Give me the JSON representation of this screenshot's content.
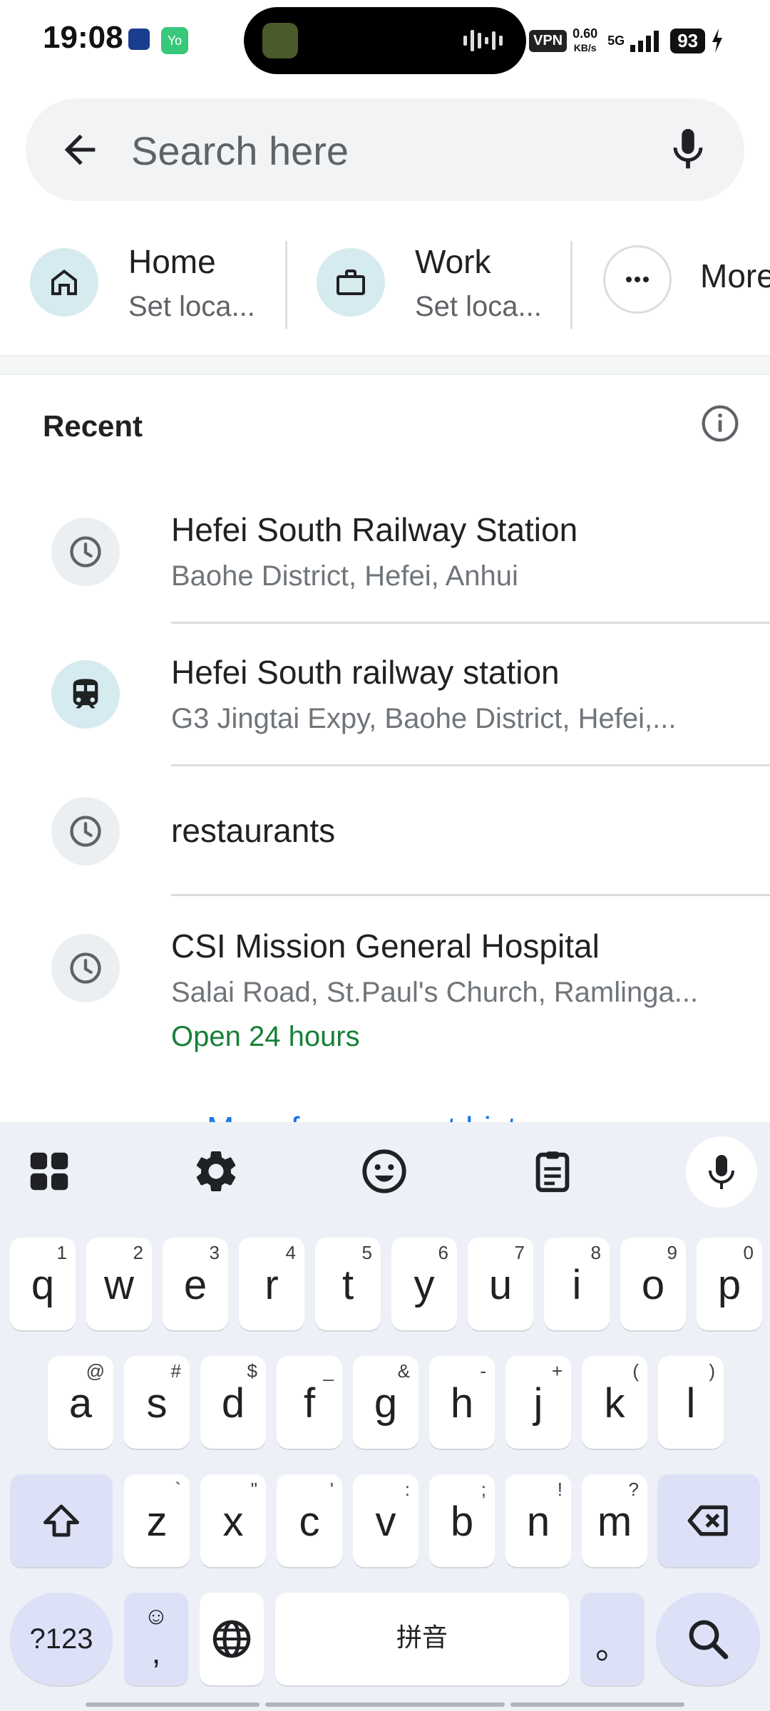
{
  "status_bar": {
    "time": "19:08",
    "app_badge": "Yo",
    "vpn": "VPN",
    "speed_value": "0.60",
    "speed_unit": "KB/s",
    "network": "5G",
    "battery": "93",
    "icons": [
      "app-notification-icon",
      "app-notification-icon",
      "audio-wave-icon",
      "signal-icon",
      "charging-icon"
    ]
  },
  "search": {
    "placeholder": "Search here",
    "back_icon": "arrow-left-icon",
    "mic_icon": "mic-icon"
  },
  "shortcuts": [
    {
      "title": "Home",
      "subtitle": "Set loca...",
      "icon": "home-icon"
    },
    {
      "title": "Work",
      "subtitle": "Set loca...",
      "icon": "briefcase-icon"
    },
    {
      "title": "More",
      "icon": "more-horiz-icon"
    }
  ],
  "recent": {
    "title": "Recent",
    "info_icon": "info-icon",
    "items": [
      {
        "title": "Hefei South Railway Station",
        "subtitle": "Baohe District, Hefei, Anhui",
        "icon": "clock-icon"
      },
      {
        "title": "Hefei South railway station",
        "subtitle": "G3 Jingtai Expy, Baohe District, Hefei,...",
        "icon": "train-icon"
      },
      {
        "title": "restaurants",
        "icon": "clock-icon"
      },
      {
        "title": "CSI Mission General Hospital",
        "subtitle": "Salai Road, St.Paul's Church, Ramlinga...",
        "status": "Open 24 hours",
        "icon": "clock-icon"
      }
    ],
    "more_link": "More from recent history"
  },
  "keyboard": {
    "toolbar_icons": [
      "apps-grid-icon",
      "settings-gear-icon",
      "emoji-icon",
      "clipboard-icon",
      "mic-icon"
    ],
    "row1": [
      {
        "k": "q",
        "a": "1"
      },
      {
        "k": "w",
        "a": "2"
      },
      {
        "k": "e",
        "a": "3"
      },
      {
        "k": "r",
        "a": "4"
      },
      {
        "k": "t",
        "a": "5"
      },
      {
        "k": "y",
        "a": "6"
      },
      {
        "k": "u",
        "a": "7"
      },
      {
        "k": "i",
        "a": "8"
      },
      {
        "k": "o",
        "a": "9"
      },
      {
        "k": "p",
        "a": "0"
      }
    ],
    "row2": [
      {
        "k": "a",
        "a": "@"
      },
      {
        "k": "s",
        "a": "#"
      },
      {
        "k": "d",
        "a": "$"
      },
      {
        "k": "f",
        "a": "_"
      },
      {
        "k": "g",
        "a": "&"
      },
      {
        "k": "h",
        "a": "-"
      },
      {
        "k": "j",
        "a": "+"
      },
      {
        "k": "k",
        "a": "("
      },
      {
        "k": "l",
        "a": ")"
      }
    ],
    "row3": [
      {
        "k": "z",
        "a": "`"
      },
      {
        "k": "x",
        "a": "\""
      },
      {
        "k": "c",
        "a": "'"
      },
      {
        "k": "v",
        "a": ":"
      },
      {
        "k": "b",
        "a": ";"
      },
      {
        "k": "n",
        "a": "!"
      },
      {
        "k": "m",
        "a": "?"
      }
    ],
    "symbols_key": "?123",
    "emoji_comma_top": "☺",
    "emoji_comma_bottom": ",",
    "space_label": "拼音",
    "period_key": "。",
    "shift_icon": "shift-icon",
    "backspace_icon": "backspace-icon",
    "globe_icon": "globe-icon",
    "search_icon": "search-icon"
  }
}
